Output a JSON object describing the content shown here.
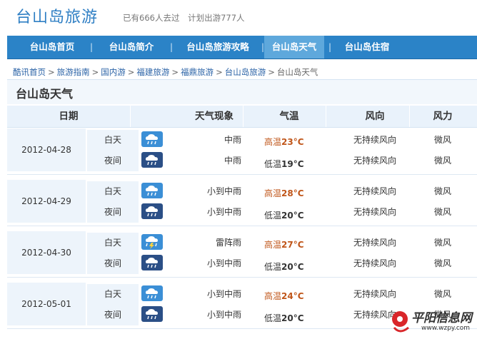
{
  "header": {
    "title": "台山岛旅游",
    "visited": "已有666人去过",
    "planned": "计划出游777人"
  },
  "nav": {
    "items": [
      {
        "label": "台山岛首页"
      },
      {
        "label": "台山岛简介"
      },
      {
        "label": "台山岛旅游攻略"
      },
      {
        "label": "台山岛天气"
      },
      {
        "label": "台山岛住宿"
      }
    ],
    "separator": "|"
  },
  "breadcrumb": {
    "items": [
      "酷讯首页",
      "旅游指南",
      "国内游",
      "福建旅游",
      "福鼎旅游",
      "台山岛旅游"
    ],
    "current": "台山岛天气",
    "separator": ">"
  },
  "page_title": "台山岛天气",
  "table": {
    "headers": [
      "日期",
      "天气现象",
      "气温",
      "风向",
      "风力"
    ],
    "days": [
      {
        "date": "2012-04-28",
        "day": {
          "label": "白天",
          "icon": "rain-cloud-icon",
          "weather": "中雨",
          "temp_label": "高温",
          "temp": "23°C",
          "wind": "无持续风向",
          "force": "微风"
        },
        "night": {
          "label": "夜间",
          "icon": "rain-cloud-night-icon",
          "weather": "中雨",
          "temp_label": "低温",
          "temp": "19°C",
          "wind": "无持续风向",
          "force": "微风"
        }
      },
      {
        "date": "2012-04-29",
        "day": {
          "label": "白天",
          "icon": "rain-cloud-icon",
          "weather": "小到中雨",
          "temp_label": "高温",
          "temp": "28°C",
          "wind": "无持续风向",
          "force": "微风"
        },
        "night": {
          "label": "夜间",
          "icon": "rain-cloud-night-icon",
          "weather": "小到中雨",
          "temp_label": "低温",
          "temp": "20°C",
          "wind": "无持续风向",
          "force": "微风"
        }
      },
      {
        "date": "2012-04-30",
        "day": {
          "label": "白天",
          "icon": "thunderstorm-icon",
          "weather": "雷阵雨",
          "temp_label": "高温",
          "temp": "27°C",
          "wind": "无持续风向",
          "force": "微风"
        },
        "night": {
          "label": "夜间",
          "icon": "rain-cloud-night-icon",
          "weather": "小到中雨",
          "temp_label": "低温",
          "temp": "20°C",
          "wind": "无持续风向",
          "force": "微风"
        }
      },
      {
        "date": "2012-05-01",
        "day": {
          "label": "白天",
          "icon": "rain-cloud-icon",
          "weather": "小到中雨",
          "temp_label": "高温",
          "temp": "24°C",
          "wind": "无持续风向",
          "force": "微风"
        },
        "night": {
          "label": "夜间",
          "icon": "rain-cloud-night-icon",
          "weather": "小到中雨",
          "temp_label": "低温",
          "temp": "20°C",
          "wind": "无持续风向",
          "force": "微风"
        }
      }
    ]
  },
  "watermark": {
    "text": "平阳信息网",
    "url": "www.wzpy.com"
  },
  "colors": {
    "brand": "#2f7fc4",
    "nav_bg": "#2b83c7",
    "nav_active": "#5ea8dc",
    "high_temp": "#c0561a",
    "icon_day": "#3b8fd6",
    "icon_night": "#2b4f86"
  }
}
